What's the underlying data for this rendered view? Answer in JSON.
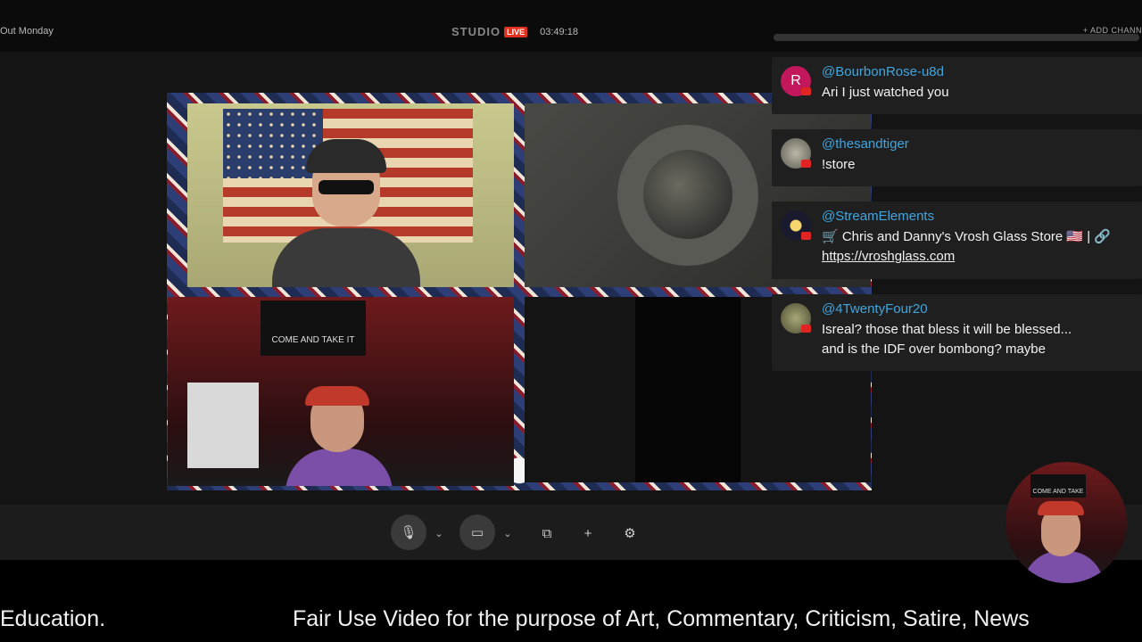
{
  "topbar": {
    "left_text": "Out Monday",
    "studio_logo": "STUDIO",
    "live_badge": "LIVE",
    "timer": "03:49:18",
    "add_channel": "+ ADD CHANN"
  },
  "camera_tiles": {
    "tile3_banner": "COME AND TAKE IT"
  },
  "controls": {
    "icons": [
      "microphone-icon",
      "chevron-down-icon",
      "camera-icon",
      "chevron-down-icon",
      "screen-share-icon",
      "plus-icon",
      "gear-icon"
    ],
    "mic_glyph": "🎙",
    "chevron_glyph": "⌄",
    "camera_glyph": "▭",
    "share_glyph": "⧉",
    "plus_glyph": "+",
    "settings_glyph": "⚙"
  },
  "chat": {
    "messages": [
      {
        "name": "@BourbonRose-u8d",
        "avatar_letter": "R",
        "avatar_color": "#c2185b",
        "text": "Ari I just watched you"
      },
      {
        "name": "@thesandtiger",
        "avatar_color": "#8a8a80",
        "text": "!store"
      },
      {
        "name": "@StreamElements",
        "avatar_color": "#1a1a2e",
        "text": "🛒 Chris and Danny's Vrosh Glass Store 🇺🇸 | 🔗",
        "link": "https://vroshglass.com"
      },
      {
        "name": "@4TwentyFour20",
        "avatar_color": "#7a7a5a",
        "text_line1": "Isreal? those that bless it will be blessed...",
        "text_line2": "and is the IDF over bombong? maybe"
      }
    ]
  },
  "pip": {
    "banner": "COME AND TAKE IT"
  },
  "ticker": {
    "segment1": "Education.",
    "segment2": "Fair Use Video for the purpose of Art, Commentary, Criticism, Satire, News"
  },
  "colors": {
    "live_red": "#e0301e",
    "chat_name_blue": "#3fa6e0",
    "chat_bubble": "#1f1f1f",
    "controls_bar": "#1c1c1c"
  }
}
